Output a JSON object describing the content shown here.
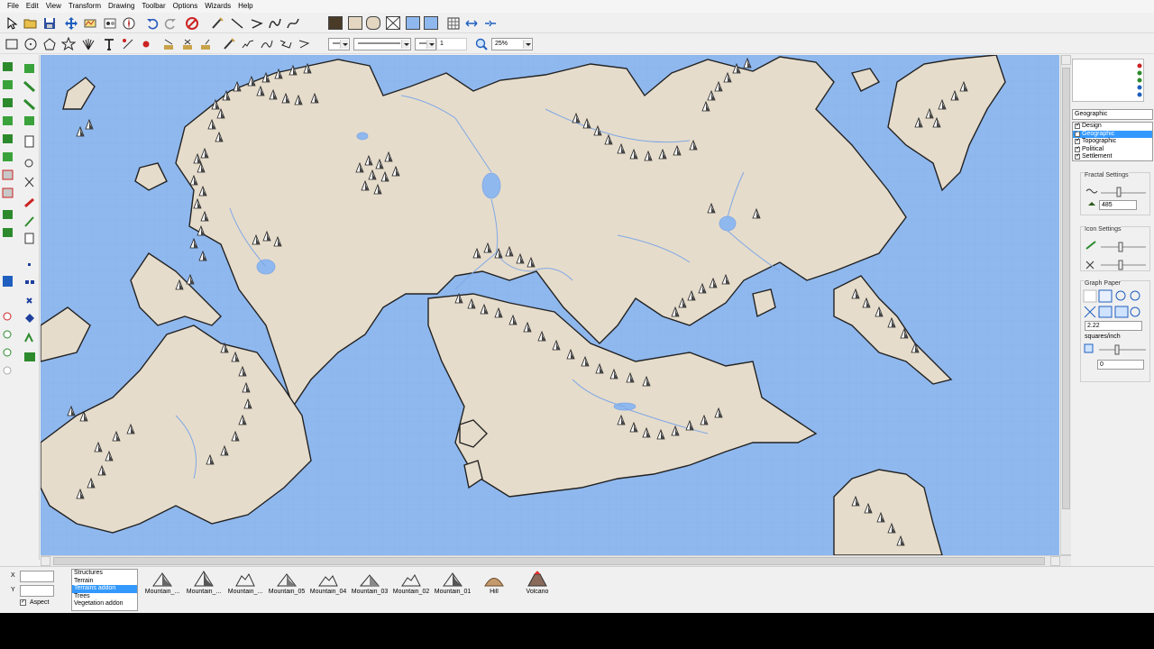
{
  "menu": [
    "File",
    "Edit",
    "View",
    "Transform",
    "Drawing",
    "Toolbar",
    "Options",
    "Wizards",
    "Help"
  ],
  "toolbar": {
    "line_style_value": "1",
    "zoom_value": "25%"
  },
  "colors": {
    "sea": "#8fb8ee",
    "land": "#e6dccb",
    "coast": "#222222",
    "river": "#7fa8e6",
    "swatch_brown": "#4a3a28",
    "swatch_tan": "#e3d7c1",
    "swatch_blue": "#8fb8ee"
  },
  "right_panel": {
    "sheet_dropdown": "Geographic",
    "layers": [
      "Design",
      "Geographic",
      "Topographic",
      "Political",
      "Settlement"
    ],
    "selected_layer": "Geographic",
    "fractal_settings_title": "Fractal Settings",
    "fractal_value": "485",
    "icon_settings_title": "Icon Settings",
    "graph_paper_title": "Graph Paper",
    "graph_value": "2.22",
    "graph_unit": "squares/inch",
    "graph_offset": "0"
  },
  "bottom": {
    "x_label": "X",
    "y_label": "Y",
    "aspect_label": "Aspect",
    "categories": [
      "Structures",
      "Terrain",
      "Terrains addon",
      "Trees",
      "Vegetation addon"
    ],
    "selected_category": "Terrains addon",
    "symbols": [
      "Mountain_...",
      "Mountain_...",
      "Mountain_...",
      "Mountain_05",
      "Mountain_04",
      "Mountain_03",
      "Mountain_02",
      "Mountain_01",
      "Hill",
      "Volcano"
    ]
  }
}
